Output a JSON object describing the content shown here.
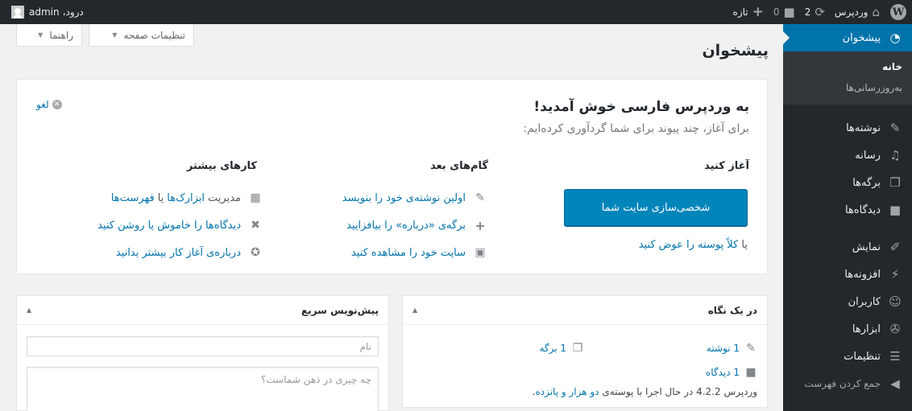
{
  "adminbar": {
    "site_name": "وردپرس",
    "updates_count": "2",
    "comments_count": "0",
    "new_label": "تازه",
    "greeting": "درود،",
    "user": "admin"
  },
  "screen_tabs": {
    "options": "تنظیمات صفحه",
    "help": "راهنما"
  },
  "page_title": "پیشخوان",
  "sidebar": {
    "dashboard": "پیشخوان",
    "sub_home": "خانه",
    "sub_updates": "به‌روزرسانی‌ها",
    "posts": "نوشته‌ها",
    "media": "رسانه",
    "pages": "برگه‌ها",
    "comments": "دیدگاه‌ها",
    "appearance": "نمایش",
    "plugins": "افزونه‌ها",
    "users": "کاربران",
    "tools": "ابزارها",
    "settings": "تنظیمات",
    "collapse": "جمع کردن فهرست"
  },
  "welcome": {
    "title": "به وردپرس فارسی خوش آمدید!",
    "about": "برای آغاز، چند پیوند برای شما گردآوری کرده‌ایم:",
    "dismiss": "لغو",
    "col1_title": "آغاز کنید",
    "cta_button": "شخصی‌سازی سایت شما",
    "or_text": "یا",
    "or_link": "کلاً پوسته را عوض کنید",
    "col2_title": "گام‌های بعد",
    "next1": "اولین نوشته‌ی خود را بنویسد",
    "next2": "برگه‌ی «درباره» را بیافزایید",
    "next3": "سایت خود را مشاهده کنید",
    "col3_title": "کارهای بیشتر",
    "more1_prefix": "مدیریت",
    "more1_link_a": "ابزارک‌ها",
    "more1_or": "یا",
    "more1_link_b": "فهرست‌ها",
    "more2": "دیدگاه‌ها را خاموش یا روشن کنید",
    "more3": "درباره‌ی آغاز کار بیشتر بدانید"
  },
  "glance": {
    "title": "در یک نگاه",
    "posts": "1 نوشته",
    "pages": "1 برگه",
    "comments": "1 دیدگاه",
    "version_prefix": "وردپرس 4.2.2 در حال اجرا با پوسته‌ی",
    "theme_link": "دو هزار و پانزده",
    "version_suffix": "."
  },
  "quick_draft": {
    "title": "پیش‌نویس سریع",
    "title_placeholder": "نام",
    "content_placeholder": "چه چیزی در ذهن شماست؟"
  }
}
